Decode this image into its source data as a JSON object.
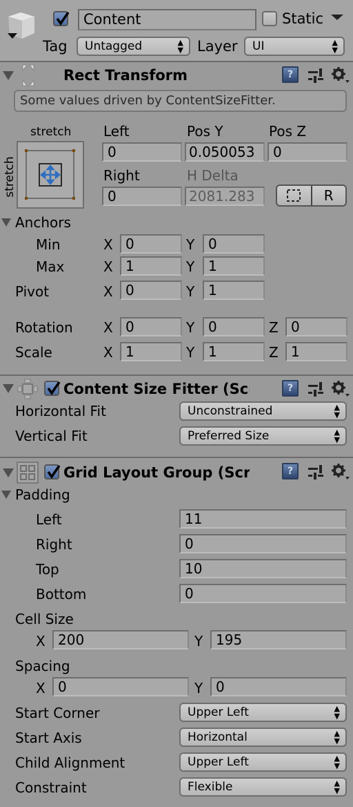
{
  "header": {
    "object_active": true,
    "object_name": "Content",
    "static_checked": false,
    "static_label": "Static",
    "tag_label": "Tag",
    "tag_value": "Untagged",
    "layer_label": "Layer",
    "layer_value": "UI"
  },
  "rect_transform": {
    "title": "Rect Transform",
    "info_message": "Some values driven by ContentSizeFitter.",
    "anchor_preset_h": "stretch",
    "anchor_preset_v": "stretch",
    "fields": {
      "left_label": "Left",
      "left_value": "0",
      "posy_label": "Pos Y",
      "posy_value": "0.050053",
      "posz_label": "Pos Z",
      "posz_value": "0",
      "right_label": "Right",
      "right_value": "0",
      "hdelta_label": "H Delta",
      "hdelta_value": "2081.283"
    },
    "raw_edit_button": "R",
    "anchors_label": "Anchors",
    "min_label": "Min",
    "min_x": "0",
    "min_y": "0",
    "max_label": "Max",
    "max_x": "1",
    "max_y": "1",
    "pivot_label": "Pivot",
    "pivot_x": "0",
    "pivot_y": "1",
    "rotation_label": "Rotation",
    "rotation_x": "0",
    "rotation_y": "0",
    "rotation_z": "0",
    "scale_label": "Scale",
    "scale_x": "1",
    "scale_y": "1",
    "scale_z": "1",
    "axis_x": "X",
    "axis_y": "Y",
    "axis_z": "Z"
  },
  "content_size_fitter": {
    "enabled": true,
    "title": "Content Size Fitter (Scri",
    "horizontal_fit_label": "Horizontal Fit",
    "horizontal_fit_value": "Unconstrained",
    "vertical_fit_label": "Vertical Fit",
    "vertical_fit_value": "Preferred Size"
  },
  "grid_layout_group": {
    "enabled": true,
    "title": "Grid Layout Group (Scri",
    "padding_label": "Padding",
    "padding_left_label": "Left",
    "padding_left": "11",
    "padding_right_label": "Right",
    "padding_right": "0",
    "padding_top_label": "Top",
    "padding_top": "10",
    "padding_bottom_label": "Bottom",
    "padding_bottom": "0",
    "cell_size_label": "Cell Size",
    "cell_x": "200",
    "cell_y": "195",
    "spacing_label": "Spacing",
    "spacing_x": "0",
    "spacing_y": "0",
    "start_corner_label": "Start Corner",
    "start_corner": "Upper Left",
    "start_axis_label": "Start Axis",
    "start_axis": "Horizontal",
    "child_alignment_label": "Child Alignment",
    "child_alignment": "Upper Left",
    "constraint_label": "Constraint",
    "constraint": "Flexible"
  },
  "colors": {
    "background": "#9a9a9a",
    "checkbox_accent": "#5a78ad",
    "anchor_arrows": "#2f6fc0",
    "anchor_corner": "#7a4a10"
  }
}
